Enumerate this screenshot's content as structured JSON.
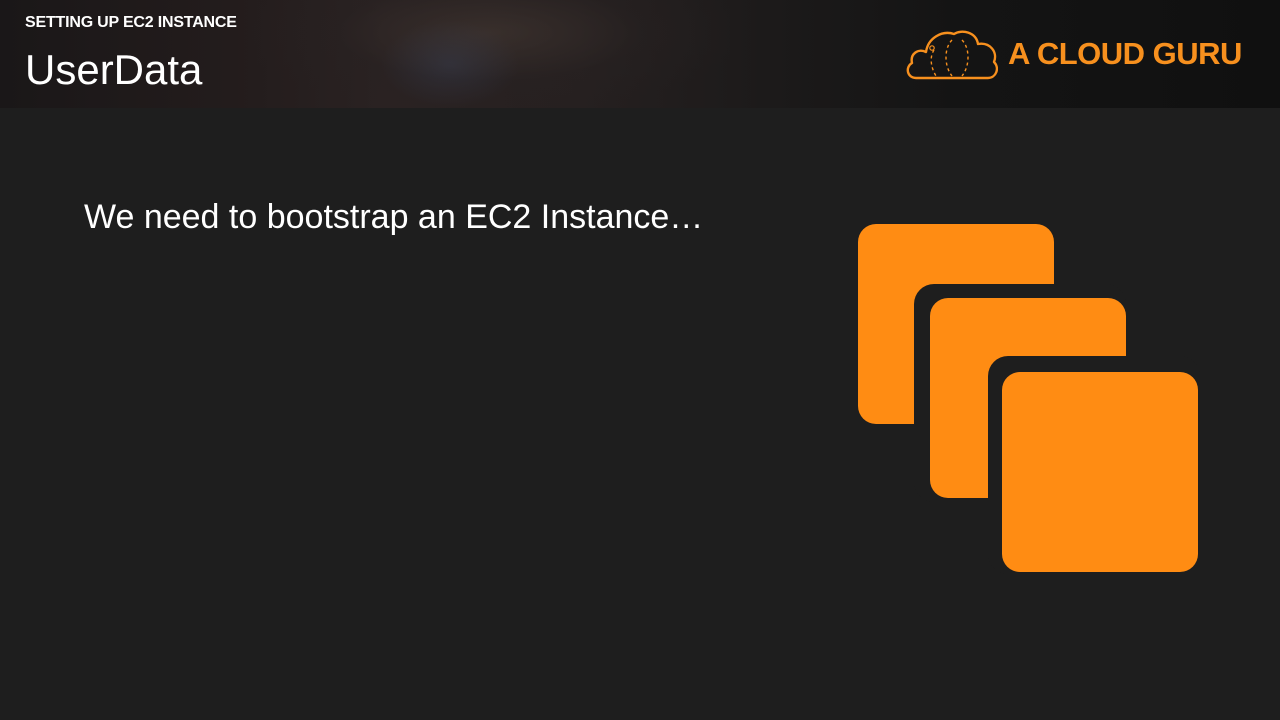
{
  "header": {
    "section": "SETTING UP EC2 INSTANCE",
    "title": "UserData"
  },
  "brand": {
    "name": "A CLOUD GURU",
    "logo_icon": "cloud-icon",
    "color": "#f7901e"
  },
  "content": {
    "text": "We need to bootstrap an EC2 Instance…",
    "illustration_icon": "ec2-instances-icon",
    "illustration_color": "#ff8c13"
  },
  "colors": {
    "background": "#1e1e1e",
    "text": "#ffffff"
  }
}
